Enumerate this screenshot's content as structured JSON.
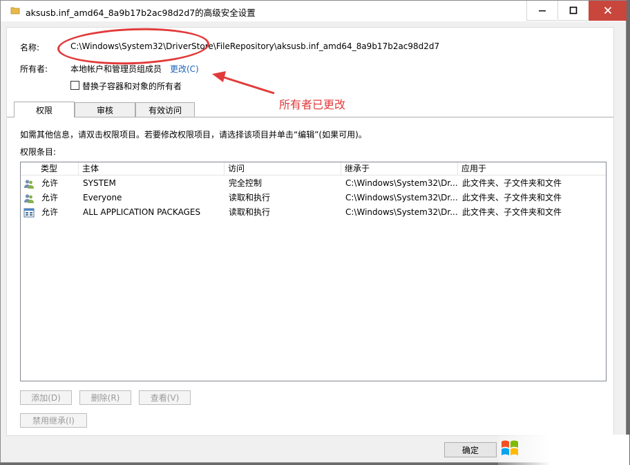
{
  "window": {
    "title": "aksusb.inf_amd64_8a9b17b2ac98d2d7的高级安全设置",
    "minimize": "—",
    "maximize": "☐",
    "close": "✕"
  },
  "info": {
    "name_label": "名称:",
    "name_value": "C:\\Windows\\System32\\DriverStore\\FileRepository\\aksusb.inf_amd64_8a9b17b2ac98d2d7",
    "owner_label": "所有者:",
    "owner_value": "本地帐户和管理员组成员",
    "owner_change": "更改(C)",
    "replace_owner_label": "替换子容器和对象的所有者"
  },
  "annotation": "所有者已更改",
  "tabs": [
    {
      "label": "权限"
    },
    {
      "label": "审核"
    },
    {
      "label": "有效访问"
    }
  ],
  "permissions": {
    "hint": "如需其他信息，请双击权限项目。若要修改权限项目，请选择该项目并单击“编辑”(如果可用)。",
    "entries_label": "权限条目:",
    "columns": [
      "类型",
      "主体",
      "访问",
      "继承于",
      "应用于"
    ],
    "rows": [
      {
        "type": "允许",
        "principal": "SYSTEM",
        "access": "完全控制",
        "inherited": "C:\\Windows\\System32\\Dr...",
        "applies": "此文件夹、子文件夹和文件",
        "icon": "users-icon"
      },
      {
        "type": "允许",
        "principal": "Everyone",
        "access": "读取和执行",
        "inherited": "C:\\Windows\\System32\\Dr...",
        "applies": "此文件夹、子文件夹和文件",
        "icon": "users-icon"
      },
      {
        "type": "允许",
        "principal": "ALL APPLICATION PACKAGES",
        "access": "读取和执行",
        "inherited": "C:\\Windows\\System32\\Dr...",
        "applies": "此文件夹、子文件夹和文件",
        "icon": "app-packages-icon"
      }
    ]
  },
  "buttons": {
    "add": "添加(D)",
    "remove": "删除(R)",
    "view": "查看(V)",
    "disable_inheritance": "禁用继承(I)",
    "ok": "确定"
  }
}
